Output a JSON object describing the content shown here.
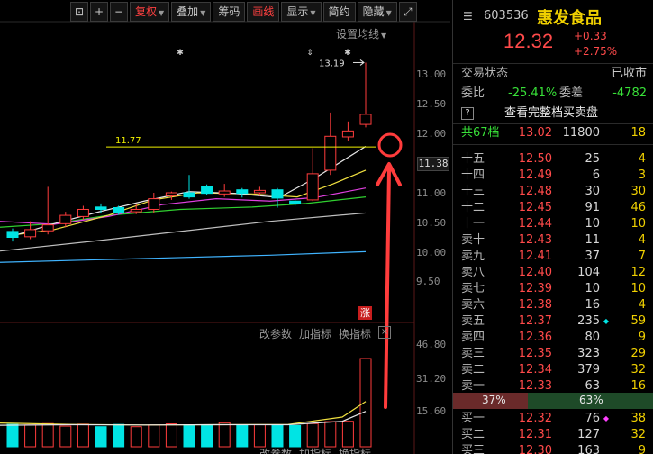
{
  "toolbar": {
    "buttons": [
      {
        "label": "",
        "icon": "lock-icon"
      },
      {
        "label": "+"
      },
      {
        "label": "−"
      },
      {
        "label": "复权",
        "dropdown": true,
        "active": true
      },
      {
        "label": "叠加",
        "dropdown": true
      },
      {
        "label": "筹码"
      },
      {
        "label": "画线",
        "active": true
      },
      {
        "label": "显示",
        "dropdown": true
      },
      {
        "label": "简约"
      },
      {
        "label": "隐藏",
        "dropdown": true
      },
      {
        "label": "",
        "icon": "fullscreen-icon"
      }
    ]
  },
  "chart": {
    "avg_setting_label": "设置均线",
    "price_labels": [
      "13.00",
      "12.50",
      "12.00",
      "11.00",
      "10.50",
      "10.00",
      "9.50"
    ],
    "current_price_label": "11.38",
    "high_annotation": "13.19",
    "line_label": "11.77",
    "zhang_tag": "涨",
    "indicator_buttons": [
      "改参数",
      "加指标",
      "换指标"
    ],
    "indicator_close": "×",
    "volume_labels": [
      "46.80",
      "31.20",
      "15.60"
    ],
    "colors": {
      "up": "#ff3c3c",
      "down": "#00e4e4",
      "ma5": "#e6e6e6",
      "ma10": "#f0e040",
      "ma20": "#e040e0",
      "ma30": "#30d030",
      "ma60": "#bfbfbf",
      "ma120": "#40b4ff",
      "hline": "#f0f000",
      "callout": "#ff3c3c"
    }
  },
  "chart_data": {
    "type": "candlestick",
    "candles": [
      {
        "o": 10.35,
        "c": 10.25,
        "h": 10.4,
        "l": 10.18
      },
      {
        "o": 10.26,
        "c": 10.38,
        "h": 10.52,
        "l": 10.22
      },
      {
        "o": 10.36,
        "c": 10.46,
        "h": 11.1,
        "l": 10.3
      },
      {
        "o": 10.48,
        "c": 10.62,
        "h": 10.68,
        "l": 10.42
      },
      {
        "o": 10.6,
        "c": 10.72,
        "h": 10.78,
        "l": 10.55
      },
      {
        "o": 10.76,
        "c": 10.72,
        "h": 10.82,
        "l": 10.66
      },
      {
        "o": 10.75,
        "c": 10.67,
        "h": 10.78,
        "l": 10.63
      },
      {
        "o": 10.68,
        "c": 10.72,
        "h": 10.82,
        "l": 10.64
      },
      {
        "o": 10.72,
        "c": 10.9,
        "h": 11.0,
        "l": 10.66
      },
      {
        "o": 10.95,
        "c": 11.0,
        "h": 11.02,
        "l": 10.88
      },
      {
        "o": 11.0,
        "c": 10.93,
        "h": 11.3,
        "l": 10.9
      },
      {
        "o": 11.1,
        "c": 10.99,
        "h": 11.14,
        "l": 10.96
      },
      {
        "o": 10.98,
        "c": 11.03,
        "h": 11.15,
        "l": 10.93
      },
      {
        "o": 11.05,
        "c": 10.99,
        "h": 11.08,
        "l": 10.92
      },
      {
        "o": 11.0,
        "c": 11.04,
        "h": 11.1,
        "l": 10.95
      },
      {
        "o": 11.05,
        "c": 10.91,
        "h": 11.08,
        "l": 10.75
      },
      {
        "o": 10.86,
        "c": 10.82,
        "h": 10.9,
        "l": 10.78
      },
      {
        "o": 10.88,
        "c": 11.32,
        "h": 11.75,
        "l": 10.86
      },
      {
        "o": 11.38,
        "c": 11.95,
        "h": 12.35,
        "l": 11.3
      },
      {
        "o": 11.94,
        "c": 12.04,
        "h": 12.2,
        "l": 11.88
      },
      {
        "o": 12.15,
        "c": 12.32,
        "h": 13.19,
        "l": 12.1
      }
    ],
    "volumes": [
      7.9,
      7.7,
      8.2,
      7.3,
      8.0,
      7.1,
      7.9,
      7.1,
      7.7,
      8.1,
      7.8,
      7.7,
      8.5,
      7.5,
      7.8,
      7.6,
      7.5,
      8.2,
      8.9,
      9.0,
      31.2
    ]
  },
  "stock": {
    "menu_icon": "hamburger-icon",
    "code": "603536",
    "name": "惠发食品",
    "price": "12.32",
    "change": "+0.33",
    "change_pct": "+2.75%"
  },
  "status": {
    "label": "交易状态",
    "value": "已收市",
    "weibi_label": "委比",
    "weibi_value": "-25.41%",
    "weicha_label": "委差",
    "weicha_value": "-4782",
    "help": "?",
    "full_book": "查看完整档买卖盘"
  },
  "total": {
    "label": "共67档",
    "price": "13.02",
    "vol": "11800",
    "num": "18"
  },
  "asks": [
    {
      "label": "十五",
      "price": "12.50",
      "vol": "25",
      "mark": "",
      "num": "4"
    },
    {
      "label": "十四",
      "price": "12.49",
      "vol": "6",
      "mark": "",
      "num": "3"
    },
    {
      "label": "十三",
      "price": "12.48",
      "vol": "30",
      "mark": "",
      "num": "30"
    },
    {
      "label": "十二",
      "price": "12.45",
      "vol": "91",
      "mark": "",
      "num": "46"
    },
    {
      "label": "十一",
      "price": "12.44",
      "vol": "10",
      "mark": "",
      "num": "10"
    },
    {
      "label": "卖十",
      "price": "12.43",
      "vol": "11",
      "mark": "",
      "num": "4"
    },
    {
      "label": "卖九",
      "price": "12.41",
      "vol": "37",
      "mark": "",
      "num": "7"
    },
    {
      "label": "卖八",
      "price": "12.40",
      "vol": "104",
      "mark": "",
      "num": "12"
    },
    {
      "label": "卖七",
      "price": "12.39",
      "vol": "10",
      "mark": "",
      "num": "10"
    },
    {
      "label": "卖六",
      "price": "12.38",
      "vol": "16",
      "mark": "",
      "num": "4"
    },
    {
      "label": "卖五",
      "price": "12.37",
      "vol": "235",
      "mark": "◆",
      "num": "59"
    },
    {
      "label": "卖四",
      "price": "12.36",
      "vol": "80",
      "mark": "",
      "num": "9"
    },
    {
      "label": "卖三",
      "price": "12.35",
      "vol": "323",
      "mark": "",
      "num": "29"
    },
    {
      "label": "卖二",
      "price": "12.34",
      "vol": "379",
      "mark": "",
      "num": "32"
    },
    {
      "label": "卖一",
      "price": "12.33",
      "vol": "63",
      "mark": "",
      "num": "16"
    }
  ],
  "ratio": {
    "sell_pct": "37%",
    "buy_pct": "63%",
    "sell_fraction": 0.37
  },
  "bids": [
    {
      "label": "买一",
      "price": "12.32",
      "vol": "76",
      "mark": "◆",
      "num": "38"
    },
    {
      "label": "买二",
      "price": "12.31",
      "vol": "127",
      "mark": "",
      "num": "32"
    },
    {
      "label": "买三",
      "price": "12.30",
      "vol": "163",
      "mark": "",
      "num": "9"
    }
  ]
}
